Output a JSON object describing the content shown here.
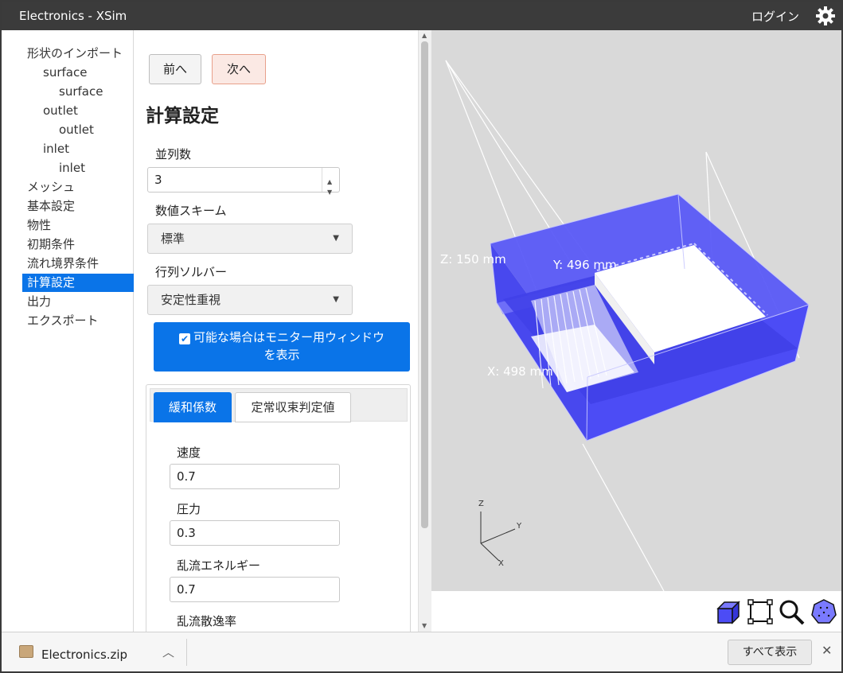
{
  "window": {
    "title": "Electronics - XSim",
    "login": "ログイン",
    "settings_icon": "gear-icon"
  },
  "nav": {
    "items": [
      {
        "label": "形状のインポート",
        "level": 0
      },
      {
        "label": "surface",
        "level": 1
      },
      {
        "label": "surface",
        "level": 2
      },
      {
        "label": "outlet",
        "level": 1
      },
      {
        "label": "outlet",
        "level": 2
      },
      {
        "label": "inlet",
        "level": 1
      },
      {
        "label": "inlet",
        "level": 2
      },
      {
        "label": "メッシュ",
        "level": 0
      },
      {
        "label": "基本設定",
        "level": 0
      },
      {
        "label": "物性",
        "level": 0
      },
      {
        "label": "初期条件",
        "level": 0
      },
      {
        "label": "流れ境界条件",
        "level": 0
      },
      {
        "label": "計算設定",
        "level": 0,
        "active": true
      },
      {
        "label": "出力",
        "level": 0
      },
      {
        "label": "エクスポート",
        "level": 0
      }
    ]
  },
  "panel": {
    "prev_label": "前へ",
    "next_label": "次へ",
    "title": "計算設定",
    "parallel": {
      "label": "並列数",
      "value": "3"
    },
    "scheme": {
      "label": "数値スキーム",
      "value": "標準"
    },
    "solver": {
      "label": "行列ソルバー",
      "value": "安定性重視"
    },
    "monitor_checkbox": {
      "line1": "可能な場合はモニター用ウィンドウ",
      "line2": "を表示",
      "checked": true
    },
    "tabs": [
      {
        "label": "緩和係数",
        "active": true
      },
      {
        "label": "定常収束判定値",
        "active": false
      }
    ],
    "relaxation": {
      "velocity": {
        "label": "速度",
        "value": "0.7"
      },
      "pressure": {
        "label": "圧力",
        "value": "0.3"
      },
      "tke": {
        "label": "乱流エネルギー",
        "value": "0.7"
      },
      "dissipation": {
        "label": "乱流散逸率"
      }
    }
  },
  "viewport": {
    "dims": {
      "z": "Z: 150 mm",
      "y": "Y: 496 mm",
      "x": "X: 498 mm"
    },
    "axes": {
      "z": "Z",
      "y": "Y",
      "x": "X"
    },
    "tools": [
      "box-view-icon",
      "fit-frame-icon",
      "zoom-icon",
      "sphere-view-icon"
    ],
    "colors": {
      "body": "#4c4cf5",
      "background": "#d9d9d9"
    }
  },
  "downloads": {
    "file": "Electronics.zip",
    "show_all": "すべて表示",
    "close": "✕"
  }
}
